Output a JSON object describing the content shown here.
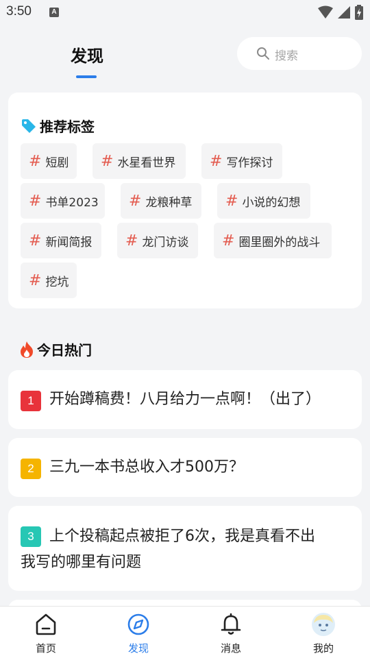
{
  "status_bar": {
    "time": "3:50",
    "notification_glyph": "A"
  },
  "header": {
    "title": "发现"
  },
  "search": {
    "placeholder": "搜索"
  },
  "tags_section": {
    "title": "推荐标签",
    "hash": "#",
    "tags": [
      {
        "label": "短剧"
      },
      {
        "label": "水星看世界"
      },
      {
        "label": "写作探讨"
      },
      {
        "label": "书单2023"
      },
      {
        "label": "龙粮种草"
      },
      {
        "label": "小说的幻想"
      },
      {
        "label": "新闻简报"
      },
      {
        "label": "龙门访谈"
      },
      {
        "label": "圈里圈外的战斗"
      },
      {
        "label": "挖坑"
      }
    ]
  },
  "hot_section": {
    "title": "今日热门",
    "items": [
      {
        "rank": "1",
        "line1": "开始蹲稿费！八月给力一点啊！（出了）",
        "line2": "",
        "color": "#e8333b"
      },
      {
        "rank": "2",
        "line1": "三九一本书总收入才500万？",
        "line2": "",
        "color": "#f5b400"
      },
      {
        "rank": "3",
        "line1": "上个投稿起点被拒了6次，我是真看不出",
        "line2": "我写的哪里有问题",
        "color": "#27c7b4"
      }
    ]
  },
  "bottom_nav": {
    "items": [
      {
        "label": "首页",
        "icon": "home-icon"
      },
      {
        "label": "发现",
        "icon": "compass-icon",
        "active": true
      },
      {
        "label": "消息",
        "icon": "bell-icon"
      },
      {
        "label": "我的",
        "icon": "avatar"
      }
    ]
  },
  "colors": {
    "accent": "#2b7de9",
    "tag_hash": "#e35b4f",
    "tag_icon": "#29b6e8",
    "fire": "#f04a2a"
  }
}
